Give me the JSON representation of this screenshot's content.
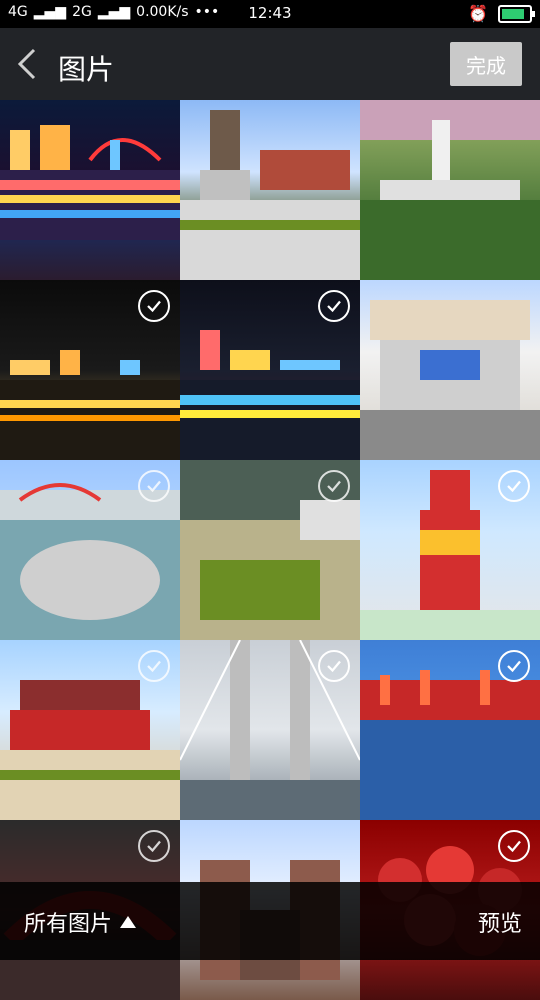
{
  "status_bar": {
    "net1": "4G",
    "net2": "2G",
    "speed": "0.00K/s",
    "dots": "•••",
    "time": "12:43"
  },
  "header": {
    "title": "图片",
    "done_label": "完成"
  },
  "grid": {
    "cells": [
      {
        "scene": "night-city-bridge",
        "selected": false
      },
      {
        "scene": "pagoda-street",
        "selected": false
      },
      {
        "scene": "pagoda-hill",
        "selected": false
      },
      {
        "scene": "night-river",
        "selected": true
      },
      {
        "scene": "night-river-boat",
        "selected": true
      },
      {
        "scene": "city-mall",
        "selected": false
      },
      {
        "scene": "river-bridge-aerial",
        "selected": false
      },
      {
        "scene": "river-island-aerial",
        "selected": false
      },
      {
        "scene": "bottle-tower",
        "selected": false
      },
      {
        "scene": "temple-tower",
        "selected": false
      },
      {
        "scene": "suspension-bridge",
        "selected": false
      },
      {
        "scene": "harbor-cranes",
        "selected": false
      },
      {
        "scene": "gate-arch",
        "selected": false
      },
      {
        "scene": "old-buildings",
        "selected": false
      },
      {
        "scene": "red-roses",
        "selected": false
      }
    ]
  },
  "bottom_bar": {
    "all_photos_label": "所有图片",
    "preview_label": "预览"
  },
  "colors": {
    "header_bg": "#222428",
    "done_bg": "#c9c9c9",
    "battery_green": "#2ecc71"
  }
}
